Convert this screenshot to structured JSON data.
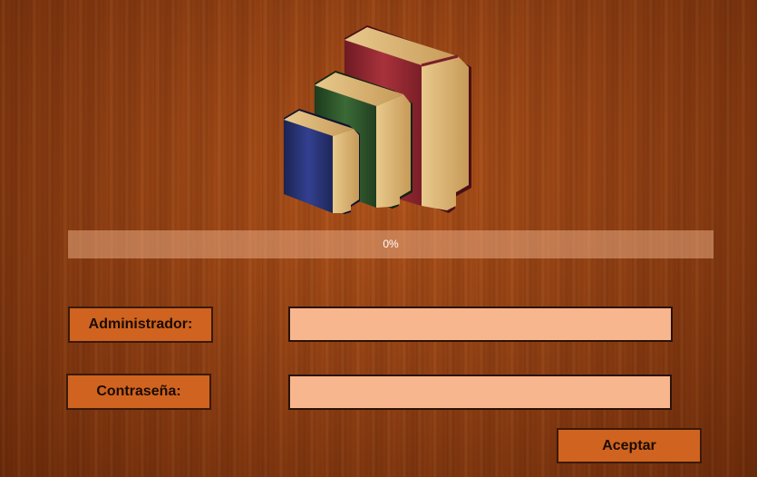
{
  "logo": {
    "icon": "books-icon"
  },
  "progress": {
    "value": 0,
    "text": "0%"
  },
  "form": {
    "admin_label": "Administrador:",
    "admin_value": "",
    "password_label": "Contraseña:",
    "password_value": ""
  },
  "actions": {
    "accept_label": "Aceptar"
  },
  "colors": {
    "background": "#8a3c12",
    "label_bg": "#d0631f",
    "field_bg": "#f8b68e",
    "border": "#3a1a08",
    "progress_bg": "#e8a880"
  }
}
